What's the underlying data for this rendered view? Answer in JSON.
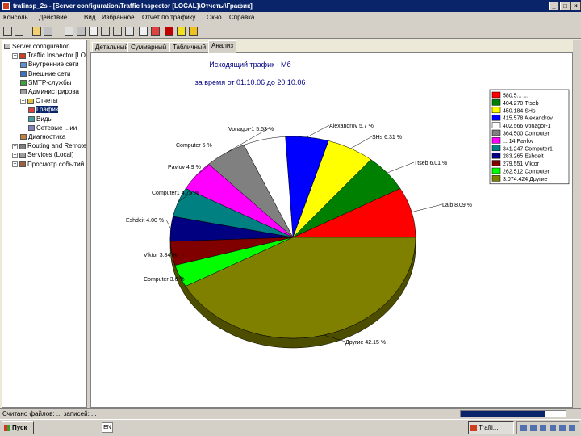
{
  "window": {
    "title": "trafinsp_2s - [Server configuration\\Traffic Inspector [LOCAL]\\Отчеты\\График]",
    "buttons": [
      "_",
      "□",
      "×"
    ]
  },
  "menu": [
    "Консоль",
    "Действие",
    "Вид",
    "Избранное",
    "Отчет по трафику",
    "Окно",
    "Справка"
  ],
  "tree": [
    {
      "label": "Server configuration",
      "level": 0,
      "toggle": ""
    },
    {
      "label": "Traffic Inspector [LOC",
      "level": 1,
      "toggle": "−"
    },
    {
      "label": "Внутренние сети",
      "level": 2,
      "toggle": ""
    },
    {
      "label": "Внешние сети",
      "level": 2,
      "toggle": ""
    },
    {
      "label": "SMTP-службы",
      "level": 2,
      "toggle": ""
    },
    {
      "label": "Администрирова",
      "level": 2,
      "toggle": ""
    },
    {
      "label": "Отчеты",
      "level": 2,
      "toggle": "−"
    },
    {
      "label": "График",
      "level": 3,
      "toggle": "",
      "selected": true
    },
    {
      "label": "Виды",
      "level": 3,
      "toggle": ""
    },
    {
      "label": "Сетевые ...ии",
      "level": 3,
      "toggle": ""
    },
    {
      "label": "Диагностика",
      "level": 2,
      "toggle": ""
    },
    {
      "label": "Routing and Remote A",
      "level": 1,
      "toggle": "+"
    },
    {
      "label": "Services (Local)",
      "level": 1,
      "toggle": "+"
    },
    {
      "label": "Просмотр событий",
      "level": 1,
      "toggle": "+"
    }
  ],
  "tabs": [
    "Детальный",
    "Суммарный",
    "Табличный",
    "Анализ"
  ],
  "active_tab": 3,
  "chart_data": {
    "type": "pie",
    "title": "Исходящий трафик - Мб",
    "subtitle": "за время от 01.10.06 до 20.10.06",
    "legend_position": "right",
    "slices": [
      {
        "legend": "580.5... ...",
        "label": "Laib 8.09 %",
        "value": 8.09,
        "color": "#ff0000"
      },
      {
        "legend": "404.270 Ttseb",
        "label": "Ttseb 6.01 %",
        "value": 6.01,
        "color": "#008000"
      },
      {
        "legend": "450.184 SHs",
        "label": "SHs 6.31 %",
        "value": 6.31,
        "color": "#ffff00"
      },
      {
        "legend": "415.578 Alexandrov",
        "label": "Alexandrov 5.7 %",
        "value": 5.7,
        "color": "#0000ff"
      },
      {
        "legend": "402.566 Vonagor-1",
        "label": "",
        "value": 5.6,
        "color": "#ffffff"
      },
      {
        "legend": "364.500 Computer",
        "label": "Vonagor-1 5.53 %",
        "value": 5.53,
        "color": "#808080"
      },
      {
        "legend": "... 14 Pavlov",
        "label": "Pavlov 4.9 %",
        "value": 4.9,
        "color": "#ff00ff"
      },
      {
        "legend": "341.247 Computer1",
        "label": "Computer1 4.75 %",
        "value": 4.75,
        "color": "#008080"
      },
      {
        "legend": "283.265 Eshdeit",
        "label": "Eshdeit 4.00 %",
        "value": 4.0,
        "color": "#000080"
      },
      {
        "legend": "279.551 Viktor",
        "label": "Viktor 3.84 %",
        "value": 3.84,
        "color": "#800000"
      },
      {
        "legend": "262.512 Computer",
        "label": "Computer 3.6 %",
        "value": 3.6,
        "color": "#00ff00"
      },
      {
        "legend": "3.074.424 Другие",
        "label": "Другие 42.15 %",
        "value": 42.15,
        "color": "#808000"
      }
    ],
    "extra_label": "Computer 5 %"
  },
  "status": {
    "text": "Считано файлов: ... записей: ...",
    "progress": 0.8
  },
  "taskbar": {
    "start": "Пуск",
    "lang": "EN",
    "task": "Traffi..."
  }
}
